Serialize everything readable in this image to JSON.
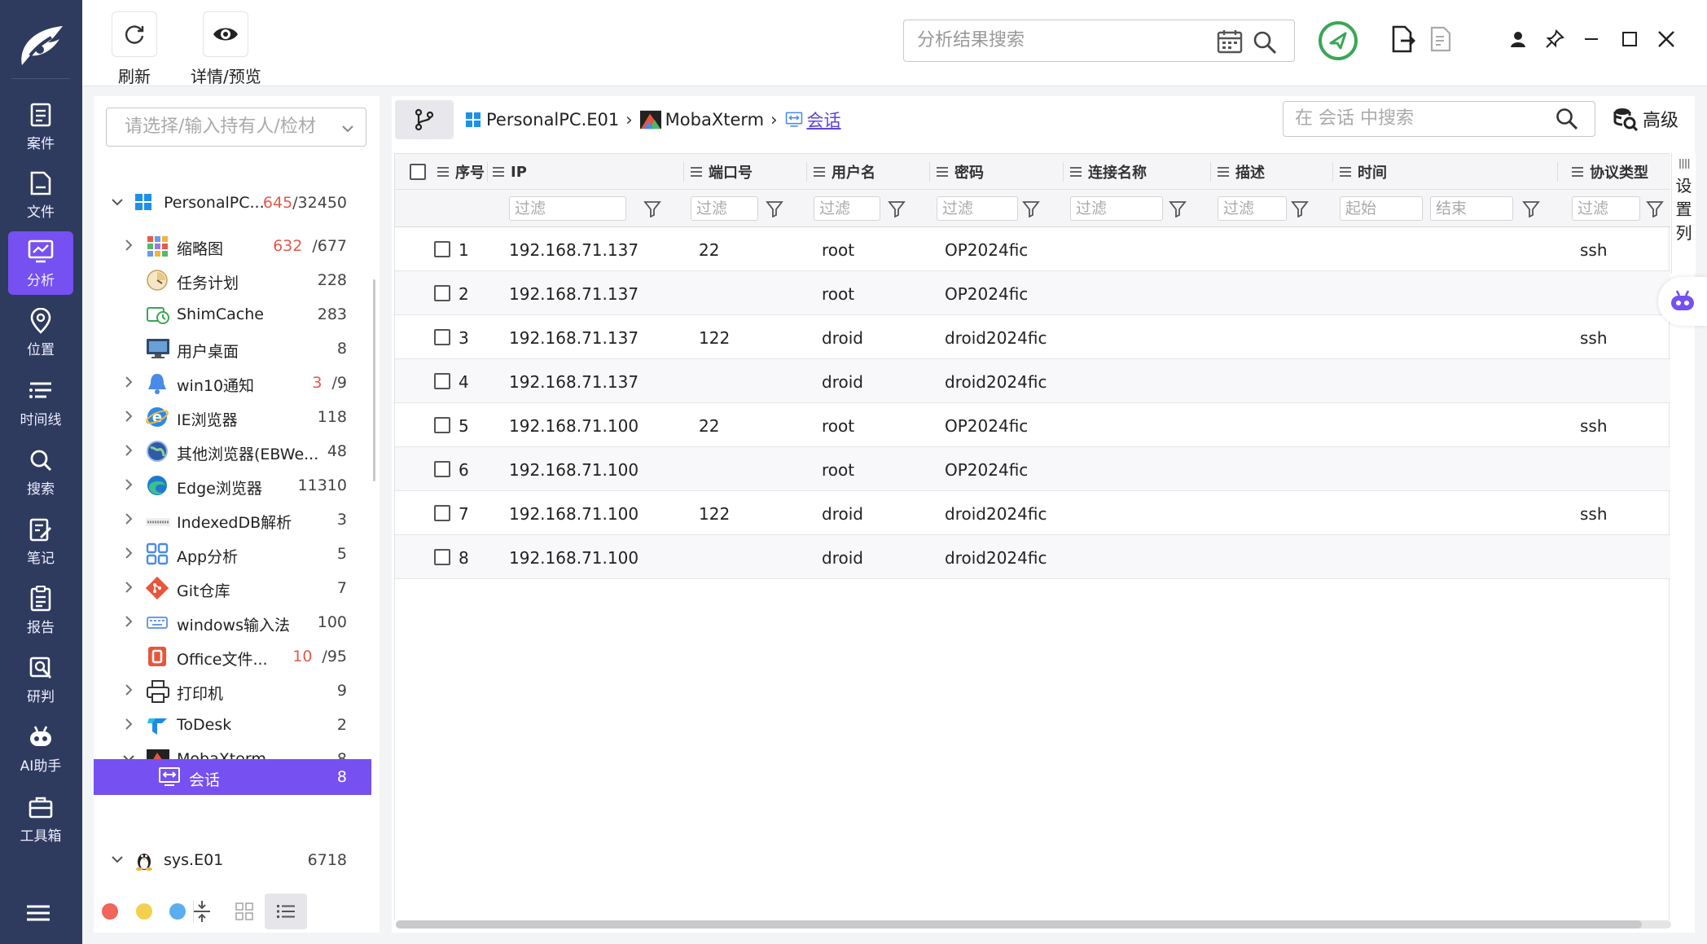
{
  "nav": {
    "items": [
      {
        "label": "案件",
        "icon": "case-icon"
      },
      {
        "label": "文件",
        "icon": "file-icon"
      },
      {
        "label": "分析",
        "icon": "analysis-icon"
      },
      {
        "label": "位置",
        "icon": "location-icon"
      },
      {
        "label": "时间线",
        "icon": "timeline-icon"
      },
      {
        "label": "搜索",
        "icon": "search-icon"
      },
      {
        "label": "笔记",
        "icon": "note-icon"
      },
      {
        "label": "报告",
        "icon": "report-icon"
      },
      {
        "label": "研判",
        "icon": "judge-icon"
      },
      {
        "label": "AI助手",
        "icon": "ai-assistant-icon"
      },
      {
        "label": "工具箱",
        "icon": "toolbox-icon"
      }
    ],
    "active": "分析"
  },
  "toolbar": {
    "refresh_label": "刷新",
    "preview_label": "详情/预览",
    "search_placeholder": "分析结果搜索"
  },
  "tree": {
    "owner_placeholder": "请选择/输入持有人/检材",
    "root1": {
      "name": "PersonalPC...",
      "count_red": "645",
      "count_total": "/32450"
    },
    "items": [
      {
        "name": "缩略图",
        "count_red": "632",
        "count_total": "/677",
        "icon": "thumbnail-icon"
      },
      {
        "name": "任务计划",
        "count_total": "228",
        "icon": "task-schedule-icon"
      },
      {
        "name": "ShimCache",
        "count_total": "283",
        "icon": "shimcache-icon"
      },
      {
        "name": "用户桌面",
        "count_total": "8",
        "icon": "user-desktop-icon"
      },
      {
        "name": "win10通知",
        "count_red": "3",
        "count_total": "/9",
        "icon": "notification-icon"
      },
      {
        "name": "IE浏览器",
        "count_total": "118",
        "icon": "ie-browser-icon"
      },
      {
        "name": "其他浏览器(EBWe...",
        "count_total": "48",
        "icon": "other-browser-icon"
      },
      {
        "name": "Edge浏览器",
        "count_total": "11310",
        "icon": "edge-browser-icon"
      },
      {
        "name": "IndexedDB解析",
        "count_total": "3",
        "icon": "indexeddb-icon"
      },
      {
        "name": "App分析",
        "count_total": "5",
        "icon": "app-analysis-icon"
      },
      {
        "name": "Git仓库",
        "count_total": "7",
        "icon": "git-icon"
      },
      {
        "name": "windows输入法",
        "count_total": "100",
        "icon": "keyboard-icon"
      },
      {
        "name": "Office文件...",
        "count_red": "10",
        "count_total": "/95",
        "icon": "office-icon"
      },
      {
        "name": "打印机",
        "count_total": "9",
        "icon": "printer-icon"
      },
      {
        "name": "ToDesk",
        "count_total": "2",
        "icon": "todesk-icon"
      },
      {
        "name": "MobaXterm",
        "count_total": "8",
        "icon": "mobaxterm-icon"
      }
    ],
    "selected": {
      "name": "会话",
      "count_total": "8"
    },
    "root2": {
      "name": "sys.E01",
      "count_total": "6718"
    }
  },
  "breadcrumb": {
    "items": [
      "PersonalPC.E01",
      "MobaXterm",
      "会话"
    ]
  },
  "session_search_placeholder": "在 会话 中搜索",
  "advanced_label": "高级",
  "column_settings_label": [
    "设",
    "置",
    "列"
  ],
  "table": {
    "columns": [
      "序号",
      "IP",
      "端口号",
      "用户名",
      "密码",
      "连接名称",
      "描述",
      "时间",
      "协议类型"
    ],
    "filter_placeholder": "过滤",
    "time_start_placeholder": "起始",
    "time_end_placeholder": "结束",
    "rows": [
      {
        "no": "1",
        "ip": "192.168.71.137",
        "port": "22",
        "user": "root",
        "pass": "OP2024fic",
        "name": "",
        "desc": "",
        "time": "",
        "proto": "ssh"
      },
      {
        "no": "2",
        "ip": "192.168.71.137",
        "port": "",
        "user": "root",
        "pass": "OP2024fic",
        "name": "",
        "desc": "",
        "time": "",
        "proto": ""
      },
      {
        "no": "3",
        "ip": "192.168.71.137",
        "port": "122",
        "user": "droid",
        "pass": "droid2024fic",
        "name": "",
        "desc": "",
        "time": "",
        "proto": "ssh"
      },
      {
        "no": "4",
        "ip": "192.168.71.137",
        "port": "",
        "user": "droid",
        "pass": "droid2024fic",
        "name": "",
        "desc": "",
        "time": "",
        "proto": ""
      },
      {
        "no": "5",
        "ip": "192.168.71.100",
        "port": "22",
        "user": "root",
        "pass": "OP2024fic",
        "name": "",
        "desc": "",
        "time": "",
        "proto": "ssh"
      },
      {
        "no": "6",
        "ip": "192.168.71.100",
        "port": "",
        "user": "root",
        "pass": "OP2024fic",
        "name": "",
        "desc": "",
        "time": "",
        "proto": ""
      },
      {
        "no": "7",
        "ip": "192.168.71.100",
        "port": "122",
        "user": "droid",
        "pass": "droid2024fic",
        "name": "",
        "desc": "",
        "time": "",
        "proto": "ssh"
      },
      {
        "no": "8",
        "ip": "192.168.71.100",
        "port": "",
        "user": "droid",
        "pass": "droid2024fic",
        "name": "",
        "desc": "",
        "time": "",
        "proto": ""
      }
    ]
  },
  "colors": {
    "nav_bg": "#2e3a5e",
    "accent": "#7650f0",
    "count_red": "#e05a4a",
    "status_green": "#3aa655",
    "dot_red": "#f0665a",
    "dot_yellow": "#f5d04e",
    "dot_blue": "#5aaef0"
  }
}
